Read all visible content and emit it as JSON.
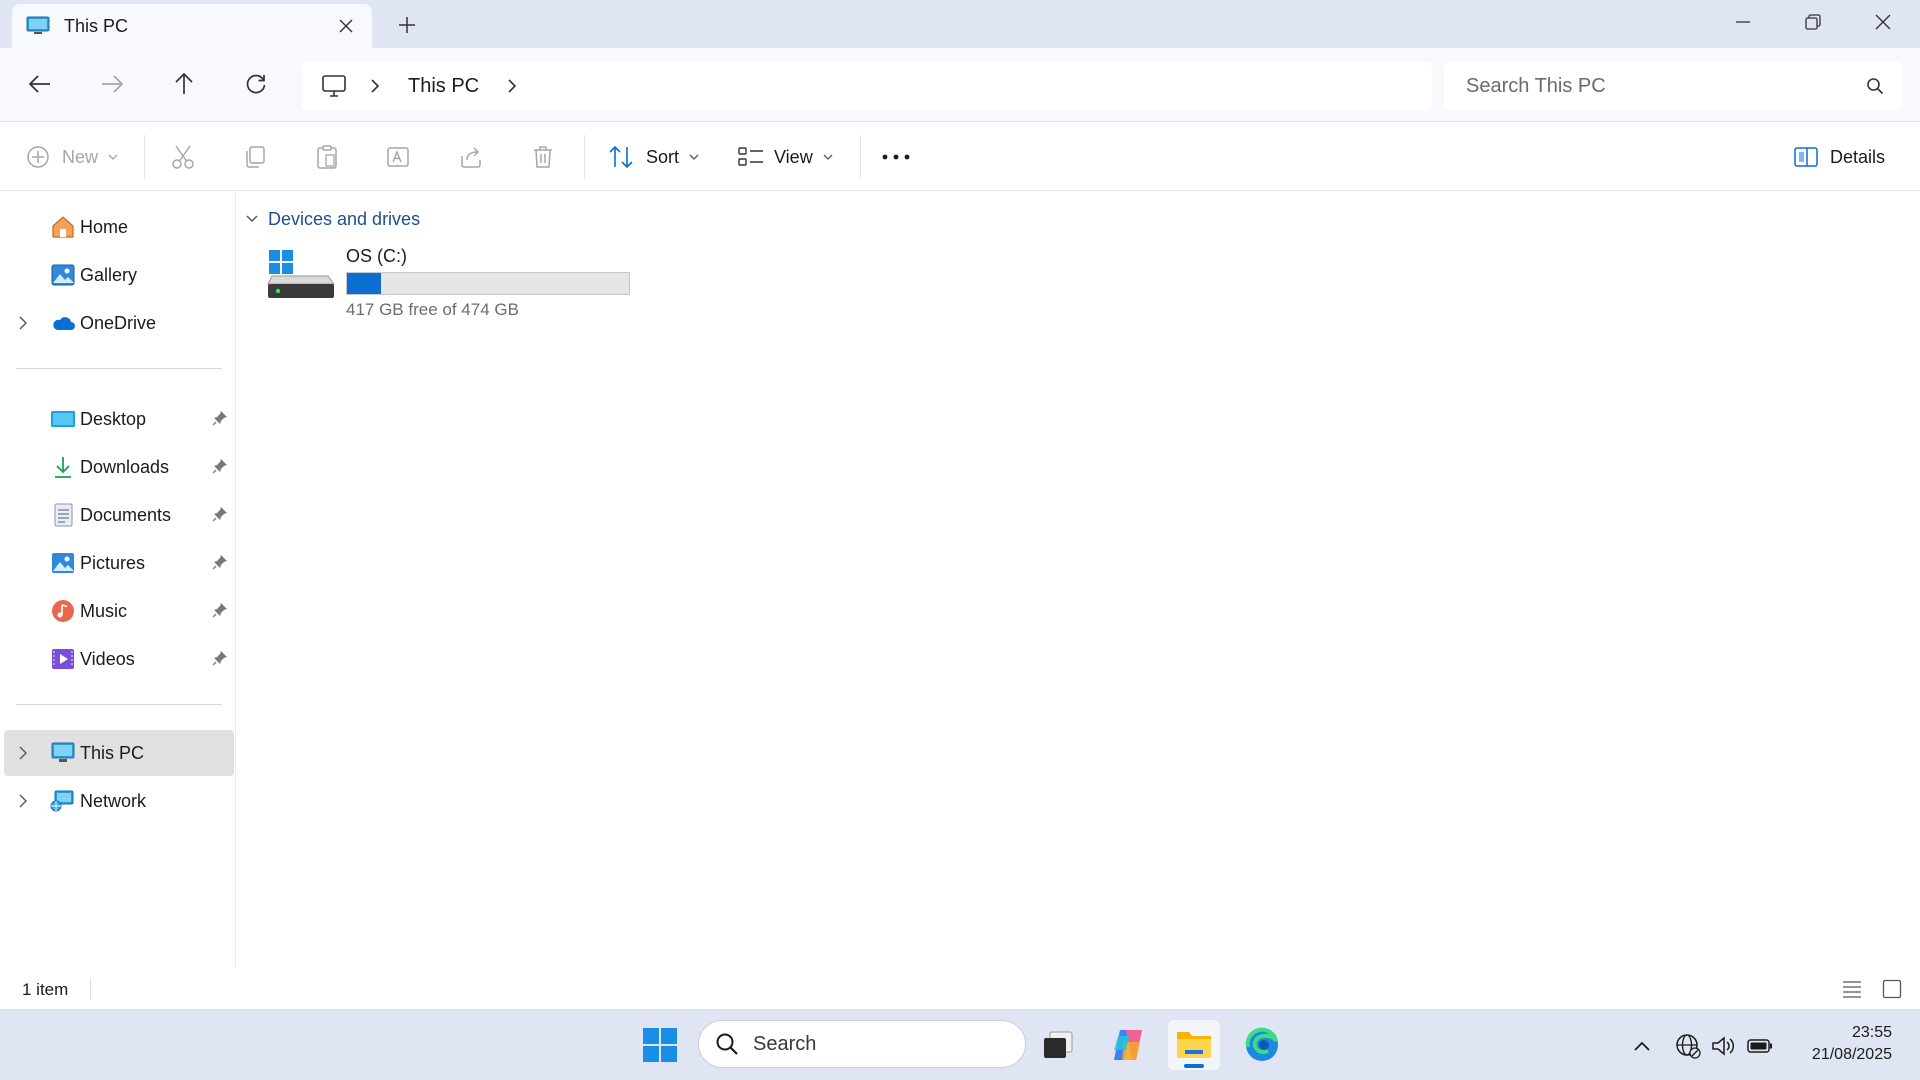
{
  "window": {
    "tab_title": "This PC",
    "tab_icon": "monitor-icon",
    "controls": [
      "minimize-icon",
      "restore-icon",
      "close-icon"
    ]
  },
  "navigation": {
    "back_icon": "arrow-left-icon",
    "forward_icon": "arrow-right-icon",
    "up_icon": "arrow-up-icon",
    "refresh_icon": "refresh-icon",
    "breadcrumb": [
      "This PC"
    ],
    "search_placeholder": "Search This PC"
  },
  "commandbar": {
    "new_label": "New",
    "sort_label": "Sort",
    "view_label": "View",
    "details_label": "Details",
    "disabled_actions": [
      "cut",
      "copy",
      "paste",
      "rename",
      "share",
      "delete"
    ]
  },
  "sidebar": {
    "top": [
      {
        "label": "Home",
        "icon": "home-icon",
        "expandable": false
      },
      {
        "label": "Gallery",
        "icon": "gallery-icon",
        "expandable": false
      },
      {
        "label": "OneDrive",
        "icon": "cloud-icon",
        "expandable": true
      }
    ],
    "pinned": [
      {
        "label": "Desktop",
        "icon": "desktop-folder-icon"
      },
      {
        "label": "Downloads",
        "icon": "download-icon"
      },
      {
        "label": "Documents",
        "icon": "documents-icon"
      },
      {
        "label": "Pictures",
        "icon": "pictures-icon"
      },
      {
        "label": "Music",
        "icon": "music-icon"
      },
      {
        "label": "Videos",
        "icon": "videos-icon"
      }
    ],
    "bottom": [
      {
        "label": "This PC",
        "icon": "monitor-icon",
        "selected": true
      },
      {
        "label": "Network",
        "icon": "network-icon",
        "selected": false
      }
    ]
  },
  "main": {
    "group_header": "Devices and drives",
    "drives": [
      {
        "name": "OS (C:)",
        "free_text": "417 GB free of 474 GB",
        "used_fraction": 0.12
      }
    ]
  },
  "status": {
    "item_count": "1 item"
  },
  "taskbar": {
    "search_placeholder": "Search",
    "apps": [
      "windows-start-icon",
      "task-view-icon",
      "copilot-icon",
      "file-explorer-icon",
      "edge-icon"
    ],
    "active_app": "file-explorer-icon",
    "time": "23:55",
    "date": "21/08/2025"
  },
  "colors": {
    "accent": "#0a6fd1",
    "group_header": "#1d4f91",
    "chrome": "#dfe5f2",
    "selected_row": "#e0e0e0"
  }
}
